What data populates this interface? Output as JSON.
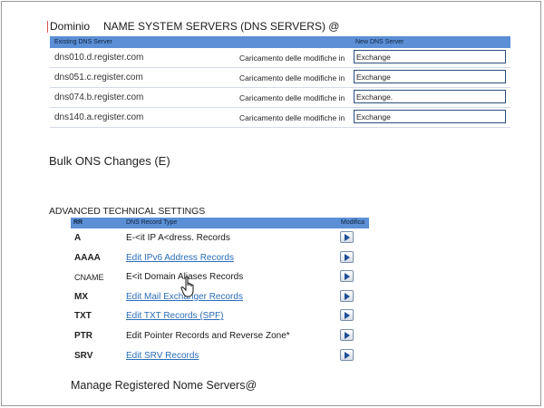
{
  "header": {
    "domain_label": "Dominio",
    "ns_title": "NAME SYSTEM SERVERS (DNS SERVERS) @"
  },
  "dns_table": {
    "col_existing": "Existing DNS Server",
    "col_new": "New DNS Server",
    "rows": [
      {
        "server": "dns010.d.register.com",
        "status": "Caricamento delle modifiche in",
        "new_value": "Exchange"
      },
      {
        "server": "dns051.c.register.com",
        "status": "Caricamento delle modifiche in",
        "new_value": "Exchange"
      },
      {
        "server": "dns074.b.register.com",
        "status": "Caricamento delle modifiche in",
        "new_value": "Exchange."
      },
      {
        "server": "dns140.a.register.com",
        "status": "Caricamento delle modifiche in",
        "new_value": "Exchange"
      }
    ]
  },
  "bulk_changes": "Bulk ONS Changes (E)",
  "advanced": {
    "title": "ADVANCED TECHNICAL SETTINGS",
    "col_rr": "RR",
    "col_type": "DNS Record Type",
    "col_modify": "Modifica",
    "records": [
      {
        "rr": "A",
        "label": "E-<it IP A<dress. Records"
      },
      {
        "rr": "AAAA",
        "label": "Edit IPv6 Address Records"
      },
      {
        "rr": "CNAME",
        "label": "E<it Domain Aliases Records"
      },
      {
        "rr": "MX",
        "label": "Edit Mail Exchanger Records"
      },
      {
        "rr": "TXT",
        "label": "Edit TXT Records (SPF)"
      },
      {
        "rr": "PTR",
        "label": "Edit Pointer Records and Reverse Zone*"
      },
      {
        "rr": "SRV",
        "label": "Edit SRV Records"
      }
    ]
  },
  "manage_ns": "Manage Registered Nome Servers@",
  "icons": {
    "go_button": "play-arrow-icon",
    "cursor": "hand-pointer-icon"
  },
  "colors": {
    "header_blue": "#5b8fd6",
    "link_blue": "#2a6db8"
  }
}
